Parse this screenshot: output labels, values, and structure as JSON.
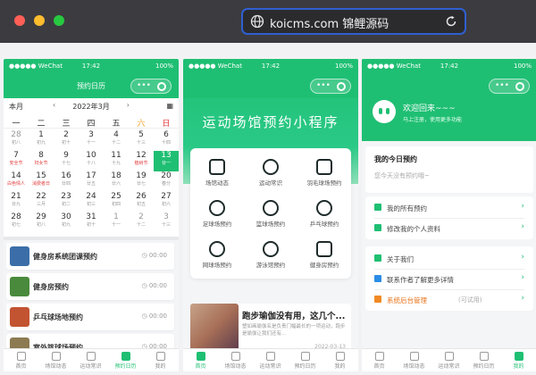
{
  "browser": {
    "url": "koicms.com 锦鲤源码"
  },
  "status": {
    "carrier": "●●●●● WeChat",
    "time": "17:42",
    "battery": "100%"
  },
  "phone1": {
    "nav_title": "预约日历",
    "calendar": {
      "month_label": "本月",
      "year_month": "2022年3月",
      "prev": "‹",
      "next": "›",
      "weekday_labels": [
        "一",
        "二",
        "三",
        "四",
        "五",
        "六",
        "日"
      ],
      "days": [
        {
          "n": "28",
          "l": "初八",
          "dim": true
        },
        {
          "n": "1",
          "l": "初九"
        },
        {
          "n": "2",
          "l": "初十"
        },
        {
          "n": "3",
          "l": "十一"
        },
        {
          "n": "4",
          "l": "十二"
        },
        {
          "n": "5",
          "l": "十三"
        },
        {
          "n": "6",
          "l": "十四"
        },
        {
          "n": "7",
          "l": "安全节",
          "red": true
        },
        {
          "n": "8",
          "l": "妇女节",
          "red": true
        },
        {
          "n": "9",
          "l": "十七"
        },
        {
          "n": "10",
          "l": "十八"
        },
        {
          "n": "11",
          "l": "十九"
        },
        {
          "n": "12",
          "l": "植树节",
          "red": true
        },
        {
          "n": "13",
          "l": "廿一",
          "today": true
        },
        {
          "n": "14",
          "l": "白色情人",
          "red": true
        },
        {
          "n": "15",
          "l": "消费者日",
          "red": true
        },
        {
          "n": "16",
          "l": "廿四"
        },
        {
          "n": "17",
          "l": "廿五"
        },
        {
          "n": "18",
          "l": "廿六"
        },
        {
          "n": "19",
          "l": "廿七"
        },
        {
          "n": "20",
          "l": "春分"
        },
        {
          "n": "21",
          "l": "廿九"
        },
        {
          "n": "22",
          "l": "三月"
        },
        {
          "n": "23",
          "l": "初二"
        },
        {
          "n": "24",
          "l": "初三"
        },
        {
          "n": "25",
          "l": "初四"
        },
        {
          "n": "26",
          "l": "初五"
        },
        {
          "n": "27",
          "l": "初六"
        },
        {
          "n": "28",
          "l": "初七"
        },
        {
          "n": "29",
          "l": "初八"
        },
        {
          "n": "30",
          "l": "初九"
        },
        {
          "n": "31",
          "l": "初十"
        },
        {
          "n": "1",
          "l": "十一",
          "dim": true
        },
        {
          "n": "2",
          "l": "十二",
          "dim": true
        },
        {
          "n": "3",
          "l": "十三",
          "dim": true
        }
      ]
    },
    "list": [
      {
        "title": "健身房系统团课预约",
        "time": "00:00",
        "color": "#3b6ea8"
      },
      {
        "title": "健身房预约",
        "time": "00:00",
        "color": "#4a8a3c"
      },
      {
        "title": "乒乓球场地预约",
        "time": "00:00",
        "color": "#c25432"
      },
      {
        "title": "室外篮球场预约",
        "time": "00:00",
        "color": "#8c7a52"
      }
    ]
  },
  "phone2": {
    "hero_title": "运动场馆预约小程序",
    "menu": [
      {
        "label": "场馆动态",
        "icon": "news-icon"
      },
      {
        "label": "运动常识",
        "icon": "medal-icon"
      },
      {
        "label": "羽毛球场预约",
        "icon": "shuttlecock-icon"
      },
      {
        "label": "足球场预约",
        "icon": "football-icon"
      },
      {
        "label": "篮球场预约",
        "icon": "basketball-icon"
      },
      {
        "label": "乒乓球预约",
        "icon": "pingpong-icon"
      },
      {
        "label": "网球场预约",
        "icon": "tennis-icon"
      },
      {
        "label": "游泳馆预约",
        "icon": "swim-icon"
      },
      {
        "label": "健身房预约",
        "icon": "boxing-glove-icon"
      }
    ],
    "news": {
      "title": "跑步瑜伽没有用，这几个...",
      "desc": "塑如画瑜伽名是负责门幅最长的一项运动，跑步是瑜伽让我们还有...",
      "date": "2022-03-13"
    }
  },
  "phone3": {
    "welcome": "欢迎回来~~~",
    "welcome_sub": "马上注册，使用更多功能",
    "today_title": "我的今日预约",
    "today_empty": "您今天没有预约哦~",
    "group1": [
      {
        "label": "我的所有预约",
        "icon": "calendar-icon"
      },
      {
        "label": "修改我的个人资料",
        "icon": "edit-icon"
      }
    ],
    "group2": [
      {
        "label": "关于我们",
        "icon": "flag-icon"
      },
      {
        "label": "联系作者了解更多详情",
        "icon": "chat-icon"
      },
      {
        "label": "系统后台管理",
        "extra": "(可试用)",
        "icon": "settings-icon"
      }
    ]
  },
  "tabs": [
    {
      "label": "首页",
      "icon": "home-icon"
    },
    {
      "label": "场馆动态",
      "icon": "news-icon"
    },
    {
      "label": "运动常识",
      "icon": "star-icon"
    },
    {
      "label": "预约日历",
      "icon": "calendar-icon"
    },
    {
      "label": "我的",
      "icon": "user-icon"
    }
  ],
  "colors": {
    "accent": "#1fbf73",
    "titlebar": "#3c3c40"
  }
}
